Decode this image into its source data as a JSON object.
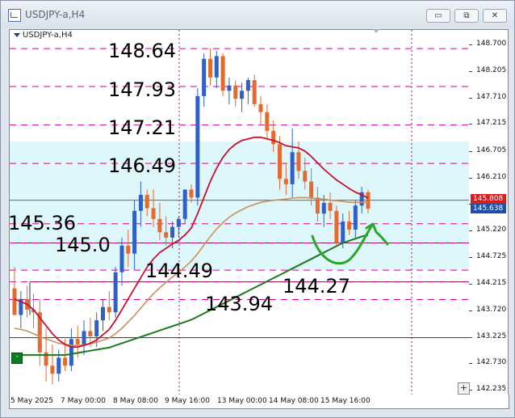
{
  "window": {
    "title": "USDJPY-a,H4",
    "buttons": {
      "minimize": "▭",
      "restore": "⧉",
      "close": "✕"
    }
  },
  "chart": {
    "symbol_label": "USDJPY-a,H4",
    "corner_button": "+",
    "indicator_button": "-"
  },
  "price_axis": {
    "ticks": [
      "148.700",
      "148.205",
      "147.710",
      "147.215",
      "146.705",
      "146.210",
      "145.715",
      "145.220",
      "144.725",
      "144.215",
      "143.720",
      "143.225",
      "142.730",
      "142.235"
    ],
    "current_bid": "145.808",
    "current_ask": "145.638",
    "bid_color": "#d31f1f",
    "ask_color": "#1f4fa8"
  },
  "time_axis": {
    "ticks": [
      "5 May 2025",
      "7 May 00:00",
      "8 May 08:00",
      "9 May 16:00",
      "13 May 00:00",
      "14 May 08:00",
      "15 May 16:00"
    ]
  },
  "annotations": {
    "levels": [
      "148.64",
      "147.93",
      "147.21",
      "146.49",
      "145.36",
      "145.0",
      "144.49",
      "144.27",
      "143.94"
    ]
  },
  "colors": {
    "bull_candle": "#2f5fc7",
    "bear_candle": "#e46a2f",
    "ma_fast": "#c8102e",
    "ma_mid": "#c9915c",
    "ma_slow": "#1b7a1b",
    "dashed_level": "#d9009a",
    "zone_fill": "#def7fb",
    "hand_drawn": "#2aa62a"
  },
  "chart_data": {
    "type": "candlestick",
    "title": "USDJPY-a,H4",
    "ylim": [
      142.235,
      148.9
    ],
    "candles_ohlc": [
      [
        144.15,
        144.55,
        143.8,
        143.65
      ],
      [
        143.65,
        144.1,
        143.4,
        143.95
      ],
      [
        143.95,
        144.2,
        143.6,
        143.75
      ],
      [
        143.75,
        144.05,
        143.4,
        143.7
      ],
      [
        143.7,
        143.95,
        142.7,
        142.95
      ],
      [
        142.95,
        143.4,
        142.4,
        142.7
      ],
      [
        142.7,
        143.1,
        142.35,
        142.55
      ],
      [
        142.55,
        143.0,
        142.4,
        142.85
      ],
      [
        142.85,
        143.2,
        142.6,
        142.7
      ],
      [
        142.7,
        143.4,
        142.6,
        143.2
      ],
      [
        143.2,
        143.45,
        142.85,
        143.1
      ],
      [
        143.1,
        143.55,
        142.9,
        143.35
      ],
      [
        143.35,
        143.6,
        143.05,
        143.25
      ],
      [
        143.25,
        143.7,
        143.05,
        143.55
      ],
      [
        143.55,
        143.95,
        143.35,
        143.8
      ],
      [
        143.8,
        144.1,
        143.55,
        143.7
      ],
      [
        143.7,
        144.55,
        143.6,
        144.45
      ],
      [
        144.45,
        145.1,
        144.2,
        144.95
      ],
      [
        144.95,
        145.25,
        144.55,
        144.8
      ],
      [
        144.8,
        145.8,
        144.5,
        145.6
      ],
      [
        145.6,
        146.15,
        145.3,
        145.9
      ],
      [
        145.9,
        146.0,
        145.5,
        145.65
      ],
      [
        145.65,
        146.0,
        145.3,
        145.45
      ],
      [
        145.45,
        145.75,
        145.05,
        145.2
      ],
      [
        145.2,
        145.5,
        144.95,
        145.1
      ],
      [
        145.1,
        145.4,
        144.9,
        145.3
      ],
      [
        145.3,
        145.5,
        145.1,
        145.45
      ],
      [
        145.45,
        145.95,
        145.35,
        146.0
      ],
      [
        146.0,
        146.1,
        145.75,
        145.85
      ],
      [
        145.85,
        147.9,
        145.7,
        147.75
      ],
      [
        147.75,
        148.55,
        147.55,
        148.45
      ],
      [
        148.45,
        148.65,
        147.95,
        148.1
      ],
      [
        148.1,
        148.6,
        147.9,
        148.5
      ],
      [
        148.5,
        148.55,
        147.75,
        147.85
      ],
      [
        147.85,
        148.1,
        147.6,
        147.95
      ],
      [
        147.95,
        148.05,
        147.55,
        147.7
      ],
      [
        147.7,
        148.0,
        147.45,
        147.85
      ],
      [
        147.85,
        148.1,
        147.6,
        148.05
      ],
      [
        148.05,
        148.15,
        147.55,
        147.6
      ],
      [
        147.6,
        147.75,
        147.2,
        147.45
      ],
      [
        147.45,
        147.6,
        146.95,
        147.1
      ],
      [
        147.1,
        147.3,
        146.7,
        146.85
      ],
      [
        146.85,
        147.0,
        146.0,
        146.2
      ],
      [
        146.2,
        146.5,
        145.9,
        146.1
      ],
      [
        146.1,
        147.15,
        145.85,
        146.7
      ],
      [
        146.7,
        146.9,
        146.2,
        146.35
      ],
      [
        146.35,
        146.6,
        146.0,
        146.15
      ],
      [
        146.15,
        146.4,
        145.7,
        145.85
      ],
      [
        145.85,
        146.05,
        145.4,
        145.55
      ],
      [
        145.55,
        145.9,
        145.3,
        145.75
      ],
      [
        145.75,
        145.95,
        145.45,
        145.6
      ],
      [
        145.6,
        145.7,
        144.95,
        145.0
      ],
      [
        145.0,
        145.55,
        144.9,
        145.4
      ],
      [
        145.4,
        145.6,
        145.15,
        145.25
      ],
      [
        145.25,
        145.8,
        145.1,
        145.7
      ],
      [
        145.7,
        146.05,
        145.55,
        145.95
      ],
      [
        145.95,
        146.0,
        145.55,
        145.64
      ]
    ],
    "ma_fast": [
      143.95,
      143.9,
      143.85,
      143.75,
      143.6,
      143.45,
      143.3,
      143.18,
      143.1,
      143.05,
      143.05,
      143.08,
      143.12,
      143.18,
      143.28,
      143.38,
      143.55,
      143.75,
      143.95,
      144.15,
      144.35,
      144.55,
      144.7,
      144.82,
      144.9,
      144.98,
      145.05,
      145.15,
      145.28,
      145.55,
      145.85,
      146.15,
      146.4,
      146.6,
      146.75,
      146.85,
      146.92,
      146.95,
      146.98,
      146.98,
      146.95,
      146.92,
      146.88,
      146.82,
      146.8,
      146.78,
      146.72,
      146.62,
      146.5,
      146.38,
      146.28,
      146.18,
      146.1,
      146.02,
      145.95,
      145.9,
      145.84
    ],
    "ma_mid": [
      143.4,
      143.38,
      143.35,
      143.3,
      143.25,
      143.2,
      143.16,
      143.12,
      143.1,
      143.08,
      143.08,
      143.09,
      143.11,
      143.14,
      143.18,
      143.22,
      143.3,
      143.4,
      143.52,
      143.64,
      143.78,
      143.92,
      144.05,
      144.16,
      144.26,
      144.36,
      144.45,
      144.55,
      144.66,
      144.8,
      144.96,
      145.12,
      145.26,
      145.38,
      145.48,
      145.56,
      145.62,
      145.68,
      145.72,
      145.76,
      145.78,
      145.8,
      145.81,
      145.82,
      145.84,
      145.85,
      145.85,
      145.84,
      145.83,
      145.82,
      145.8,
      145.79,
      145.78,
      145.76,
      145.76,
      145.76,
      145.76
    ],
    "ma_slow": [
      142.9,
      142.9,
      142.9,
      142.9,
      142.9,
      142.9,
      142.9,
      142.9,
      142.9,
      142.92,
      142.94,
      142.96,
      142.98,
      143.0,
      143.02,
      143.04,
      143.08,
      143.12,
      143.16,
      143.2,
      143.24,
      143.28,
      143.32,
      143.36,
      143.4,
      143.44,
      143.48,
      143.52,
      143.56,
      143.62,
      143.68,
      143.74,
      143.8,
      143.86,
      143.92,
      143.98,
      144.04,
      144.1,
      144.16,
      144.22,
      144.28,
      144.34,
      144.4,
      144.46,
      144.52,
      144.58,
      144.64,
      144.7,
      144.76,
      144.82,
      144.88,
      144.94,
      145.0,
      145.04,
      145.08,
      145.12,
      145.15
    ],
    "dashed_levels": [
      148.64,
      147.93,
      147.21,
      146.49,
      145.36,
      145.0,
      144.49,
      144.27,
      143.94
    ],
    "solid_levels": [
      145.8,
      145.0,
      144.27,
      143.225
    ],
    "zone": [
      144.49,
      146.9
    ]
  }
}
